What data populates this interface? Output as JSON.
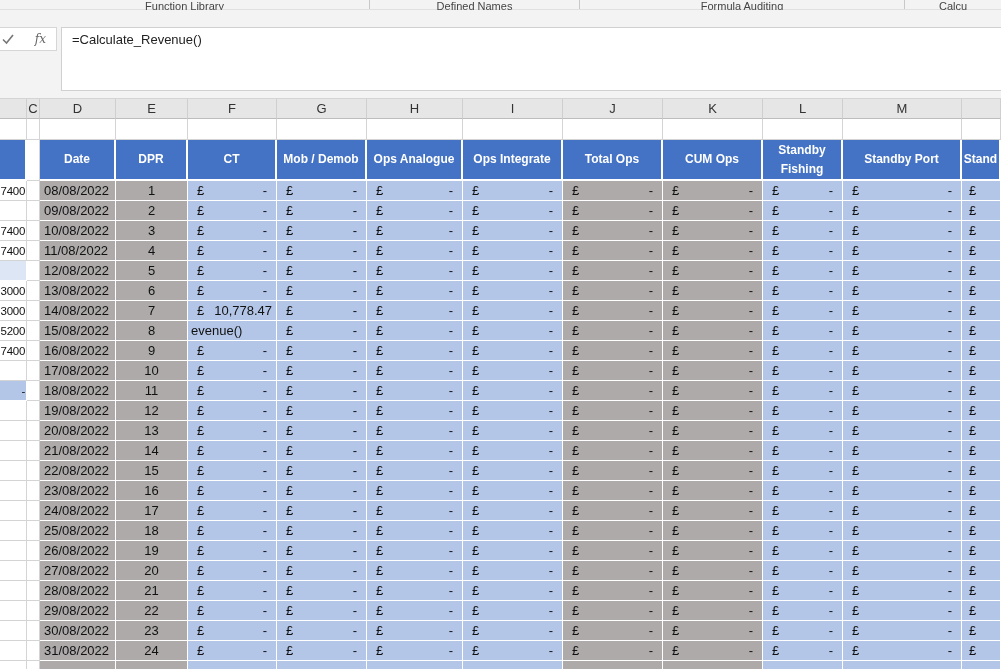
{
  "ribbon_groups": [
    "Function Library",
    "Defined Names",
    "Formula Auditing",
    "Calcu"
  ],
  "formula_bar": {
    "function_button": "fx",
    "formula": "=Calculate_Revenue()"
  },
  "column_letters": [
    "C",
    "D",
    "E",
    "F",
    "G",
    "H",
    "I",
    "J",
    "K",
    "L",
    "M"
  ],
  "table_headers": [
    "Date",
    "DPR",
    "CT",
    "Mob / Demob",
    "Ops Analogue",
    "Ops Integrate",
    "Total Ops",
    "CUM Ops",
    "Standby Fishing",
    "Standby Port",
    "Stand"
  ],
  "rows": [
    {
      "column_b": {
        "text": "7400",
        "color": "#ffffff"
      },
      "date": "08/08/2022",
      "dpr": "1",
      "cells": [
        [
          "£",
          "-"
        ],
        [
          "£",
          "-"
        ],
        [
          "£",
          "-"
        ],
        [
          "£",
          "-"
        ],
        [
          "£",
          "-"
        ],
        [
          "£",
          "-"
        ],
        [
          "£",
          "-"
        ],
        [
          "£",
          "-"
        ]
      ],
      "column_n": "£"
    },
    {
      "column_b": {
        "color": "#ffffff"
      },
      "date": "09/08/2022",
      "dpr": "2",
      "cells": [
        [
          "£",
          "-"
        ],
        [
          "£",
          "-"
        ],
        [
          "£",
          "-"
        ],
        [
          "£",
          "-"
        ],
        [
          "£",
          "-"
        ],
        [
          "£",
          "-"
        ],
        [
          "£",
          "-"
        ],
        [
          "£",
          "-"
        ]
      ],
      "column_n": "£"
    },
    {
      "column_b": {
        "text": "7400",
        "color": "#ffffff"
      },
      "date": "10/08/2022",
      "dpr": "3",
      "cells": [
        [
          "£",
          "-"
        ],
        [
          "£",
          "-"
        ],
        [
          "£",
          "-"
        ],
        [
          "£",
          "-"
        ],
        [
          "£",
          "-"
        ],
        [
          "£",
          "-"
        ],
        [
          "£",
          "-"
        ],
        [
          "£",
          "-"
        ]
      ],
      "column_n": "£"
    },
    {
      "column_b": {
        "text": "7400",
        "color": "#ffffff"
      },
      "date": "11/08/2022",
      "dpr": "4",
      "cells": [
        [
          "£",
          "-"
        ],
        [
          "£",
          "-"
        ],
        [
          "£",
          "-"
        ],
        [
          "£",
          "-"
        ],
        [
          "£",
          "-"
        ],
        [
          "£",
          "-"
        ],
        [
          "£",
          "-"
        ],
        [
          "£",
          "-"
        ]
      ],
      "column_n": "£"
    },
    {
      "column_b": {
        "color": "#dce6f4"
      },
      "date": "12/08/2022",
      "dpr": "5",
      "cells": [
        [
          "£",
          "-"
        ],
        [
          "£",
          "-"
        ],
        [
          "£",
          "-"
        ],
        [
          "£",
          "-"
        ],
        [
          "£",
          "-"
        ],
        [
          "£",
          "-"
        ],
        [
          "£",
          "-"
        ],
        [
          "£",
          "-"
        ]
      ],
      "column_n": "£"
    },
    {
      "column_b": {
        "text": "3000",
        "color": "#ffffff"
      },
      "date": "13/08/2022",
      "dpr": "6",
      "cells": [
        [
          "£",
          "-"
        ],
        [
          "£",
          "-"
        ],
        [
          "£",
          "-"
        ],
        [
          "£",
          "-"
        ],
        [
          "£",
          "-"
        ],
        [
          "£",
          "-"
        ],
        [
          "£",
          "-"
        ],
        [
          "£",
          "-"
        ]
      ],
      "column_n": "£"
    },
    {
      "column_b": {
        "text": "3000",
        "color": "#ffffff"
      },
      "date": "14/08/2022",
      "dpr": "7",
      "cells": [
        [
          "£",
          "10,778.47"
        ],
        [
          "£",
          "-"
        ],
        [
          "£",
          "-"
        ],
        [
          "£",
          "-"
        ],
        [
          "£",
          "-"
        ],
        [
          "£",
          "-"
        ],
        [
          "£",
          "-"
        ],
        [
          "£",
          "-"
        ]
      ],
      "column_n": "£"
    },
    {
      "column_b": {
        "text": "5200",
        "color": "#ffffff"
      },
      "date": "15/08/2022",
      "dpr": "8",
      "cells": [
        [
          "evenue()"
        ],
        [
          "£",
          "-"
        ],
        [
          "£",
          "-"
        ],
        [
          "£",
          "-"
        ],
        [
          "£",
          "-"
        ],
        [
          "£",
          "-"
        ],
        [
          "£",
          "-"
        ],
        [
          "£",
          "-"
        ]
      ],
      "column_n": "£"
    },
    {
      "column_b": {
        "text": "7400",
        "color": "#ffffff"
      },
      "date": "16/08/2022",
      "dpr": "9",
      "cells": [
        [
          "£",
          "-"
        ],
        [
          "£",
          "-"
        ],
        [
          "£",
          "-"
        ],
        [
          "£",
          "-"
        ],
        [
          "£",
          "-"
        ],
        [
          "£",
          "-"
        ],
        [
          "£",
          "-"
        ],
        [
          "£",
          "-"
        ]
      ],
      "column_n": "£"
    },
    {
      "column_b": {
        "color": "#ffffff"
      },
      "date": "17/08/2022",
      "dpr": "10",
      "cells": [
        [
          "£",
          "-"
        ],
        [
          "£",
          "-"
        ],
        [
          "£",
          "-"
        ],
        [
          "£",
          "-"
        ],
        [
          "£",
          "-"
        ],
        [
          "£",
          "-"
        ],
        [
          "£",
          "-"
        ],
        [
          "£",
          "-"
        ]
      ],
      "column_n": "£"
    },
    {
      "column_b": {
        "text": "-",
        "color": "#b4c6e7"
      },
      "date": "18/08/2022",
      "dpr": "11",
      "cells": [
        [
          "£",
          "-"
        ],
        [
          "£",
          "-"
        ],
        [
          "£",
          "-"
        ],
        [
          "£",
          "-"
        ],
        [
          "£",
          "-"
        ],
        [
          "£",
          "-"
        ],
        [
          "£",
          "-"
        ],
        [
          "£",
          "-"
        ]
      ],
      "column_n": "£"
    },
    {
      "column_b": {
        "color": "#ffffff"
      },
      "date": "19/08/2022",
      "dpr": "12",
      "cells": [
        [
          "£",
          "-"
        ],
        [
          "£",
          "-"
        ],
        [
          "£",
          "-"
        ],
        [
          "£",
          "-"
        ],
        [
          "£",
          "-"
        ],
        [
          "£",
          "-"
        ],
        [
          "£",
          "-"
        ],
        [
          "£",
          "-"
        ]
      ],
      "column_n": "£"
    },
    {
      "column_b": {
        "color": "#ffffff"
      },
      "date": "20/08/2022",
      "dpr": "13",
      "cells": [
        [
          "£",
          "-"
        ],
        [
          "£",
          "-"
        ],
        [
          "£",
          "-"
        ],
        [
          "£",
          "-"
        ],
        [
          "£",
          "-"
        ],
        [
          "£",
          "-"
        ],
        [
          "£",
          "-"
        ],
        [
          "£",
          "-"
        ]
      ],
      "column_n": "£"
    },
    {
      "column_b": {
        "color": "#ffffff"
      },
      "date": "21/08/2022",
      "dpr": "14",
      "cells": [
        [
          "£",
          "-"
        ],
        [
          "£",
          "-"
        ],
        [
          "£",
          "-"
        ],
        [
          "£",
          "-"
        ],
        [
          "£",
          "-"
        ],
        [
          "£",
          "-"
        ],
        [
          "£",
          "-"
        ],
        [
          "£",
          "-"
        ]
      ],
      "column_n": "£"
    },
    {
      "column_b": {
        "color": "#ffffff"
      },
      "date": "22/08/2022",
      "dpr": "15",
      "cells": [
        [
          "£",
          "-"
        ],
        [
          "£",
          "-"
        ],
        [
          "£",
          "-"
        ],
        [
          "£",
          "-"
        ],
        [
          "£",
          "-"
        ],
        [
          "£",
          "-"
        ],
        [
          "£",
          "-"
        ],
        [
          "£",
          "-"
        ]
      ],
      "column_n": "£"
    },
    {
      "column_b": {
        "color": "#ffffff"
      },
      "date": "23/08/2022",
      "dpr": "16",
      "cells": [
        [
          "£",
          "-"
        ],
        [
          "£",
          "-"
        ],
        [
          "£",
          "-"
        ],
        [
          "£",
          "-"
        ],
        [
          "£",
          "-"
        ],
        [
          "£",
          "-"
        ],
        [
          "£",
          "-"
        ],
        [
          "£",
          "-"
        ]
      ],
      "column_n": "£"
    },
    {
      "column_b": {
        "color": "#ffffff"
      },
      "date": "24/08/2022",
      "dpr": "17",
      "cells": [
        [
          "£",
          "-"
        ],
        [
          "£",
          "-"
        ],
        [
          "£",
          "-"
        ],
        [
          "£",
          "-"
        ],
        [
          "£",
          "-"
        ],
        [
          "£",
          "-"
        ],
        [
          "£",
          "-"
        ],
        [
          "£",
          "-"
        ]
      ],
      "column_n": "£"
    },
    {
      "column_b": {
        "color": "#ffffff"
      },
      "date": "25/08/2022",
      "dpr": "18",
      "cells": [
        [
          "£",
          "-"
        ],
        [
          "£",
          "-"
        ],
        [
          "£",
          "-"
        ],
        [
          "£",
          "-"
        ],
        [
          "£",
          "-"
        ],
        [
          "£",
          "-"
        ],
        [
          "£",
          "-"
        ],
        [
          "£",
          "-"
        ]
      ],
      "column_n": "£"
    },
    {
      "column_b": {
        "color": "#ffffff"
      },
      "date": "26/08/2022",
      "dpr": "19",
      "cells": [
        [
          "£",
          "-"
        ],
        [
          "£",
          "-"
        ],
        [
          "£",
          "-"
        ],
        [
          "£",
          "-"
        ],
        [
          "£",
          "-"
        ],
        [
          "£",
          "-"
        ],
        [
          "£",
          "-"
        ],
        [
          "£",
          "-"
        ]
      ],
      "column_n": "£"
    },
    {
      "column_b": {
        "color": "#ffffff"
      },
      "date": "27/08/2022",
      "dpr": "20",
      "cells": [
        [
          "£",
          "-"
        ],
        [
          "£",
          "-"
        ],
        [
          "£",
          "-"
        ],
        [
          "£",
          "-"
        ],
        [
          "£",
          "-"
        ],
        [
          "£",
          "-"
        ],
        [
          "£",
          "-"
        ],
        [
          "£",
          "-"
        ]
      ],
      "column_n": "£"
    },
    {
      "column_b": {
        "color": "#ffffff"
      },
      "date": "28/08/2022",
      "dpr": "21",
      "cells": [
        [
          "£",
          "-"
        ],
        [
          "£",
          "-"
        ],
        [
          "£",
          "-"
        ],
        [
          "£",
          "-"
        ],
        [
          "£",
          "-"
        ],
        [
          "£",
          "-"
        ],
        [
          "£",
          "-"
        ],
        [
          "£",
          "-"
        ]
      ],
      "column_n": "£"
    },
    {
      "column_b": {
        "color": "#ffffff"
      },
      "date": "29/08/2022",
      "dpr": "22",
      "cells": [
        [
          "£",
          "-"
        ],
        [
          "£",
          "-"
        ],
        [
          "£",
          "-"
        ],
        [
          "£",
          "-"
        ],
        [
          "£",
          "-"
        ],
        [
          "£",
          "-"
        ],
        [
          "£",
          "-"
        ],
        [
          "£",
          "-"
        ]
      ],
      "column_n": "£"
    },
    {
      "column_b": {
        "color": "#ffffff"
      },
      "date": "30/08/2022",
      "dpr": "23",
      "cells": [
        [
          "£",
          "-"
        ],
        [
          "£",
          "-"
        ],
        [
          "£",
          "-"
        ],
        [
          "£",
          "-"
        ],
        [
          "£",
          "-"
        ],
        [
          "£",
          "-"
        ],
        [
          "£",
          "-"
        ],
        [
          "£",
          "-"
        ]
      ],
      "column_n": "£"
    },
    {
      "column_b": {
        "color": "#ffffff"
      },
      "date": "31/08/2022",
      "dpr": "24",
      "cells": [
        [
          "£",
          "-"
        ],
        [
          "£",
          "-"
        ],
        [
          "£",
          "-"
        ],
        [
          "£",
          "-"
        ],
        [
          "£",
          "-"
        ],
        [
          "£",
          "-"
        ],
        [
          "£",
          "-"
        ],
        [
          "£",
          "-"
        ]
      ],
      "column_n": "£"
    }
  ]
}
